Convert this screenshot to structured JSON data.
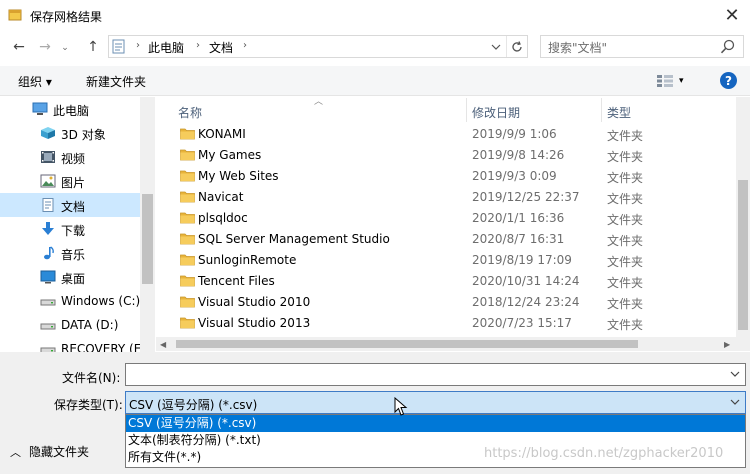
{
  "window": {
    "title": "保存网格结果",
    "close_label": "✕"
  },
  "address": {
    "crumbs": [
      "此电脑",
      "文档"
    ],
    "search_placeholder": "搜索\"文档\""
  },
  "toolbar": {
    "organize_label": "组织 ▾",
    "new_folder_label": "新建文件夹",
    "help_label": "?"
  },
  "nav_items": [
    {
      "label": "此电脑",
      "icon": "computer-icon"
    },
    {
      "label": "3D 对象",
      "icon": "cube-icon"
    },
    {
      "label": "视频",
      "icon": "video-icon"
    },
    {
      "label": "图片",
      "icon": "image-icon"
    },
    {
      "label": "文档",
      "icon": "document-icon",
      "selected": true
    },
    {
      "label": "下载",
      "icon": "download-icon"
    },
    {
      "label": "音乐",
      "icon": "music-icon"
    },
    {
      "label": "桌面",
      "icon": "desktop-icon"
    },
    {
      "label": "Windows (C:)",
      "icon": "drive-icon"
    },
    {
      "label": "DATA (D:)",
      "icon": "drive-icon"
    },
    {
      "label": "RECOVERY (E",
      "icon": "drive-icon"
    }
  ],
  "columns": {
    "name": "名称",
    "date": "修改日期",
    "type": "类型"
  },
  "files": [
    {
      "name": "KONAMI",
      "date": "2019/9/9 1:06",
      "type": "文件夹"
    },
    {
      "name": "My Games",
      "date": "2019/9/8 14:26",
      "type": "文件夹"
    },
    {
      "name": "My Web Sites",
      "date": "2019/9/3 0:09",
      "type": "文件夹"
    },
    {
      "name": "Navicat",
      "date": "2019/12/25 22:37",
      "type": "文件夹"
    },
    {
      "name": "plsqldoc",
      "date": "2020/1/1 16:36",
      "type": "文件夹"
    },
    {
      "name": "SQL Server Management Studio",
      "date": "2020/8/7 16:31",
      "type": "文件夹"
    },
    {
      "name": "SunloginRemote",
      "date": "2019/8/19 17:09",
      "type": "文件夹"
    },
    {
      "name": "Tencent Files",
      "date": "2020/10/31 14:24",
      "type": "文件夹"
    },
    {
      "name": "Visual Studio 2010",
      "date": "2018/12/24 23:24",
      "type": "文件夹"
    },
    {
      "name": "Visual Studio 2013",
      "date": "2020/7/23 15:17",
      "type": "文件夹"
    }
  ],
  "form": {
    "filename_label": "文件名(N):",
    "filename_value": "",
    "filetype_label": "保存类型(T):",
    "filetype_value": "CSV (逗号分隔) (*.csv)",
    "filetype_options": [
      "CSV (逗号分隔) (*.csv)",
      "文本(制表符分隔) (*.txt)",
      "所有文件(*.*)"
    ]
  },
  "footer": {
    "hide_folders_label": "隐藏文件夹",
    "watermark": "https://blog.csdn.net/zgphacker2010"
  },
  "colors": {
    "selection": "#cce8ff",
    "option_highlight": "#0078d7",
    "folder": "#e8b43a"
  }
}
